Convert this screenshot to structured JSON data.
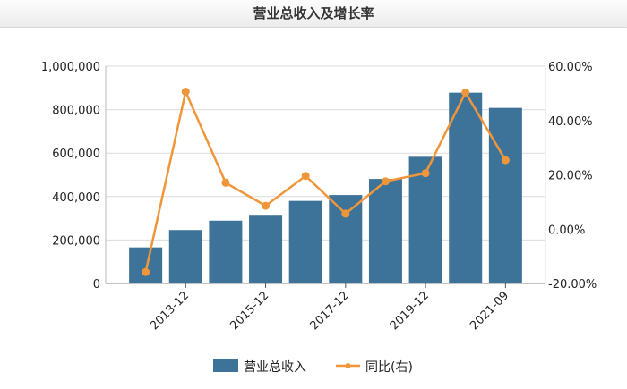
{
  "header": {
    "title": "营业总收入及增长率"
  },
  "chart_data": {
    "type": "bar+line",
    "title": "营业总收入及增长率",
    "tick_labels": [
      "",
      "2013-12",
      "",
      "2015-12",
      "",
      "2017-12",
      "",
      "2019-12",
      "",
      "2021-09"
    ],
    "series": [
      {
        "name": "营业总收入",
        "type": "bar",
        "axis": "left",
        "color": "#3d7399",
        "values": [
          166000,
          246000,
          289000,
          316000,
          380000,
          407000,
          481000,
          583000,
          878000,
          808000
        ]
      },
      {
        "name": "同比(右)",
        "type": "line",
        "axis": "right",
        "color": "#f0963a",
        "values": [
          -15.8,
          50.6,
          17.1,
          8.6,
          19.6,
          5.7,
          17.6,
          20.6,
          50.3,
          25.4
        ]
      }
    ],
    "left_axis": {
      "range": [
        0,
        1000000
      ],
      "ticks": [
        0,
        200000,
        400000,
        600000,
        800000,
        1000000
      ],
      "tick_labels": [
        "0",
        "200,000",
        "400,000",
        "600,000",
        "800,000",
        "1,000,000"
      ]
    },
    "right_axis": {
      "range": [
        -20,
        60
      ],
      "ticks": [
        -20,
        0,
        20,
        40,
        60
      ],
      "tick_labels": [
        "-20.00%",
        "0.00%",
        "20.00%",
        "40.00%",
        "60.00%"
      ]
    },
    "grid": true,
    "legend": {
      "position": "bottom",
      "items": [
        "营业总收入",
        "同比(右)"
      ]
    }
  }
}
